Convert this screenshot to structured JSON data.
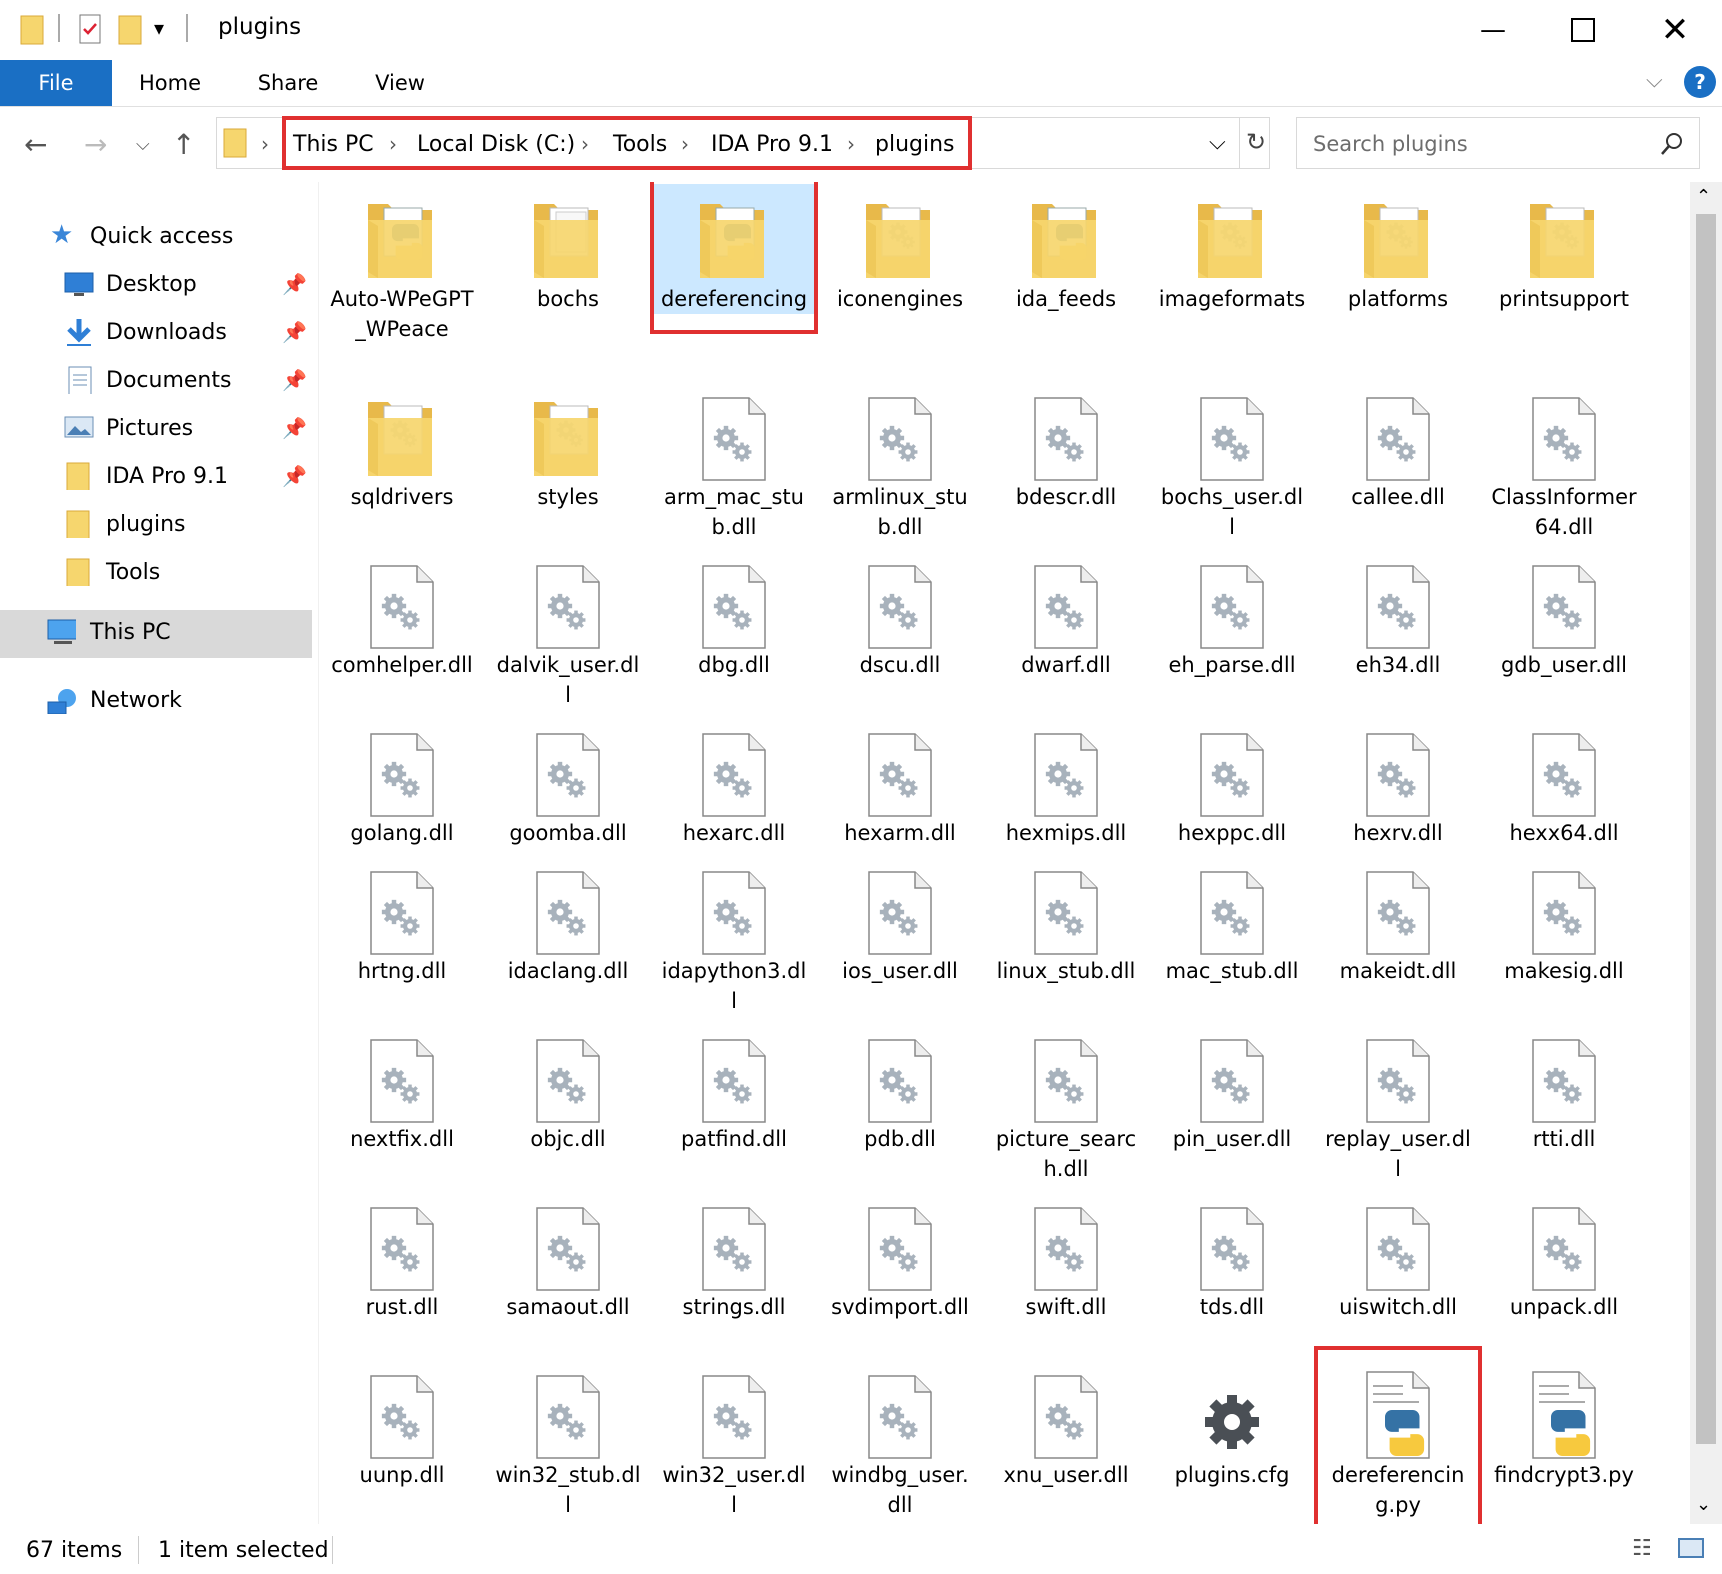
{
  "window": {
    "title": "plugins"
  },
  "ribbon": {
    "tabs": [
      "File",
      "Home",
      "Share",
      "View"
    ],
    "help": "?"
  },
  "address": {
    "crumbs": [
      "This PC",
      "Local Disk (C:)",
      "Tools",
      "IDA Pro 9.1",
      "plugins"
    ],
    "search_placeholder": "Search plugins"
  },
  "nav": {
    "quick_access": "Quick access",
    "pinned": [
      "Desktop",
      "Downloads",
      "Documents",
      "Pictures",
      "IDA Pro 9.1"
    ],
    "unpinned": [
      "plugins",
      "Tools"
    ],
    "this_pc": "This PC",
    "network": "Network"
  },
  "items": [
    {
      "name": "Auto-WPeGPT_WPeace",
      "type": "folder-py"
    },
    {
      "name": "bochs",
      "type": "folder-doc"
    },
    {
      "name": "dereferencing",
      "type": "folder-py",
      "selected": true
    },
    {
      "name": "iconengines",
      "type": "folder-gear"
    },
    {
      "name": "ida_feeds",
      "type": "folder-py"
    },
    {
      "name": "imageformats",
      "type": "folder-gear"
    },
    {
      "name": "platforms",
      "type": "folder-gear"
    },
    {
      "name": "printsupport",
      "type": "folder-gear"
    },
    {
      "name": "sqldrivers",
      "type": "folder-gear"
    },
    {
      "name": "styles",
      "type": "folder-gear"
    },
    {
      "name": "arm_mac_stub.dll",
      "type": "dll"
    },
    {
      "name": "armlinux_stub.dll",
      "type": "dll"
    },
    {
      "name": "bdescr.dll",
      "type": "dll"
    },
    {
      "name": "bochs_user.dll",
      "type": "dll"
    },
    {
      "name": "callee.dll",
      "type": "dll"
    },
    {
      "name": "ClassInformer64.dll",
      "type": "dll"
    },
    {
      "name": "comhelper.dll",
      "type": "dll"
    },
    {
      "name": "dalvik_user.dll",
      "type": "dll"
    },
    {
      "name": "dbg.dll",
      "type": "dll"
    },
    {
      "name": "dscu.dll",
      "type": "dll"
    },
    {
      "name": "dwarf.dll",
      "type": "dll"
    },
    {
      "name": "eh_parse.dll",
      "type": "dll"
    },
    {
      "name": "eh34.dll",
      "type": "dll"
    },
    {
      "name": "gdb_user.dll",
      "type": "dll"
    },
    {
      "name": "golang.dll",
      "type": "dll"
    },
    {
      "name": "goomba.dll",
      "type": "dll"
    },
    {
      "name": "hexarc.dll",
      "type": "dll"
    },
    {
      "name": "hexarm.dll",
      "type": "dll"
    },
    {
      "name": "hexmips.dll",
      "type": "dll"
    },
    {
      "name": "hexppc.dll",
      "type": "dll"
    },
    {
      "name": "hexrv.dll",
      "type": "dll"
    },
    {
      "name": "hexx64.dll",
      "type": "dll"
    },
    {
      "name": "hrtng.dll",
      "type": "dll"
    },
    {
      "name": "idaclang.dll",
      "type": "dll"
    },
    {
      "name": "idapython3.dll",
      "type": "dll"
    },
    {
      "name": "ios_user.dll",
      "type": "dll"
    },
    {
      "name": "linux_stub.dll",
      "type": "dll"
    },
    {
      "name": "mac_stub.dll",
      "type": "dll"
    },
    {
      "name": "makeidt.dll",
      "type": "dll"
    },
    {
      "name": "makesig.dll",
      "type": "dll"
    },
    {
      "name": "nextfix.dll",
      "type": "dll"
    },
    {
      "name": "objc.dll",
      "type": "dll"
    },
    {
      "name": "patfind.dll",
      "type": "dll"
    },
    {
      "name": "pdb.dll",
      "type": "dll"
    },
    {
      "name": "picture_search.dll",
      "type": "dll"
    },
    {
      "name": "pin_user.dll",
      "type": "dll"
    },
    {
      "name": "replay_user.dll",
      "type": "dll"
    },
    {
      "name": "rtti.dll",
      "type": "dll"
    },
    {
      "name": "rust.dll",
      "type": "dll"
    },
    {
      "name": "samaout.dll",
      "type": "dll"
    },
    {
      "name": "strings.dll",
      "type": "dll"
    },
    {
      "name": "svdimport.dll",
      "type": "dll"
    },
    {
      "name": "swift.dll",
      "type": "dll"
    },
    {
      "name": "tds.dll",
      "type": "dll"
    },
    {
      "name": "uiswitch.dll",
      "type": "dll"
    },
    {
      "name": "unpack.dll",
      "type": "dll"
    },
    {
      "name": "uunp.dll",
      "type": "dll"
    },
    {
      "name": "win32_stub.dll",
      "type": "dll"
    },
    {
      "name": "win32_user.dll",
      "type": "dll"
    },
    {
      "name": "windbg_user.dll",
      "type": "dll"
    },
    {
      "name": "xnu_user.dll",
      "type": "dll"
    },
    {
      "name": "plugins.cfg",
      "type": "cfg"
    },
    {
      "name": "dereferencing.py",
      "type": "py",
      "highlight": true
    },
    {
      "name": "findcrypt3.py",
      "type": "py"
    }
  ],
  "status": {
    "count": "67 items",
    "selection": "1 item selected"
  }
}
